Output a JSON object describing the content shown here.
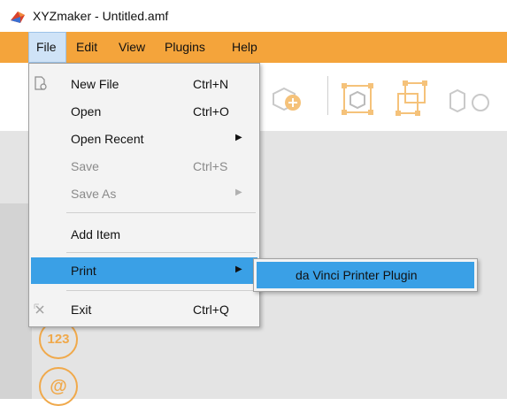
{
  "window": {
    "title": "XYZmaker - Untitled.amf",
    "app_icon": "xyzmaker-logo-icon"
  },
  "menubar": {
    "items": [
      {
        "label": "File",
        "active": true
      },
      {
        "label": "Edit",
        "active": false
      },
      {
        "label": "View",
        "active": false
      },
      {
        "label": "Plugins",
        "active": false
      },
      {
        "label": "Help",
        "active": false
      }
    ]
  },
  "file_menu": {
    "items": [
      {
        "label": "New File",
        "shortcut": "Ctrl+N",
        "icon": "new-file-icon",
        "enabled": true
      },
      {
        "label": "Open",
        "shortcut": "Ctrl+O",
        "enabled": true
      },
      {
        "label": "Open Recent",
        "submenu_arrow": "▶",
        "enabled": true
      },
      {
        "label": "Save",
        "shortcut": "Ctrl+S",
        "enabled": false
      },
      {
        "label": "Save As",
        "submenu_arrow": "▶",
        "enabled": false
      },
      {
        "label": "Add Item",
        "enabled": true
      },
      {
        "label": "Print",
        "submenu_arrow": "▶",
        "enabled": true,
        "highlighted": true
      },
      {
        "label": "Exit",
        "shortcut": "Ctrl+Q",
        "icon": "exit-icon",
        "enabled": true
      }
    ]
  },
  "print_submenu": {
    "items": [
      {
        "label": "da Vinci Printer Plugin",
        "highlighted": true
      }
    ]
  },
  "toolbar": {
    "icons": [
      "add-object-icon",
      "group-icon",
      "ungroup-icon",
      "shapes-icon"
    ]
  },
  "side_panel": {
    "badges": [
      {
        "label": "123",
        "icon": "number-badge-icon"
      },
      {
        "label": "@",
        "icon": "at-badge-icon"
      }
    ]
  },
  "colors": {
    "menubar": "#f4a43b",
    "highlight": "#3aa0e6",
    "accent": "#f0a94b"
  }
}
